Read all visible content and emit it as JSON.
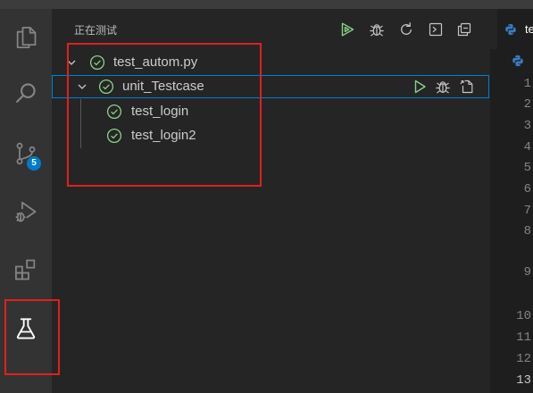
{
  "activity_bar": {
    "items": [
      {
        "icon": "explorer-icon"
      },
      {
        "icon": "search-icon"
      },
      {
        "icon": "source-control-icon",
        "badge": "5"
      },
      {
        "icon": "run-debug-icon"
      },
      {
        "icon": "extensions-icon"
      },
      {
        "icon": "testing-flask-icon",
        "active": true
      }
    ]
  },
  "sidebar": {
    "title": "正在测试",
    "header_actions": [
      {
        "icon": "run-all-tests-icon"
      },
      {
        "icon": "debug-all-tests-icon"
      },
      {
        "icon": "refresh-tests-icon"
      },
      {
        "icon": "show-output-icon"
      },
      {
        "icon": "collapse-all-icon"
      }
    ],
    "tree": [
      {
        "label": "test_autom.py",
        "status": "passed",
        "expanded": true,
        "depth": 0
      },
      {
        "label": "unit_Testcase",
        "status": "passed",
        "expanded": true,
        "depth": 1,
        "focused": true,
        "actions": [
          {
            "icon": "run-test-icon"
          },
          {
            "icon": "debug-test-icon"
          },
          {
            "icon": "go-to-test-icon"
          }
        ]
      },
      {
        "label": "test_login",
        "status": "passed",
        "depth": 2
      },
      {
        "label": "test_login2",
        "status": "passed",
        "depth": 2
      }
    ]
  },
  "editor": {
    "tab_label": "te",
    "tab_icon": "python-file-icon",
    "line_numbers": [
      "1",
      "2",
      "3",
      "4",
      "5",
      "6",
      "7",
      "8",
      "9",
      "10",
      "11",
      "12",
      "13"
    ],
    "current_line": 13
  },
  "colors": {
    "passed": "#89d185",
    "accent": "#007acc",
    "focus": "#007fd4",
    "annotation": "#e0201e"
  }
}
